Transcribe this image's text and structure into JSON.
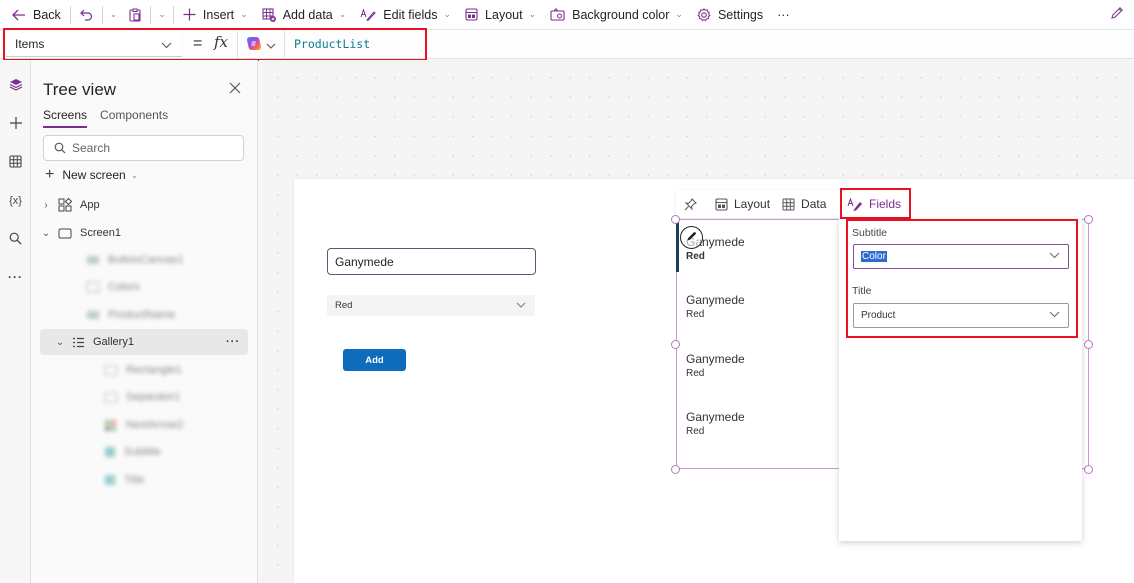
{
  "command_bar": {
    "back": "Back",
    "insert": "Insert",
    "add_data": "Add data",
    "edit_fields": "Edit fields",
    "layout": "Layout",
    "background_color": "Background color",
    "settings": "Settings",
    "more": "···"
  },
  "formula_bar": {
    "property": "Items",
    "equals": "=",
    "fx": "fx",
    "formula": "ProductList"
  },
  "tree_view": {
    "title": "Tree view",
    "tabs": [
      {
        "label": "Screens",
        "active": true
      },
      {
        "label": "Components",
        "active": false
      }
    ],
    "search_placeholder": "Search",
    "new_screen": "New screen",
    "items": [
      {
        "label": "App",
        "level": 0,
        "expanded": false
      },
      {
        "label": "Screen1",
        "level": 0,
        "expanded": true
      },
      {
        "label": "ButtonCanvas1",
        "level": 1,
        "blurred": true
      },
      {
        "label": "Colors",
        "level": 1,
        "blurred": true
      },
      {
        "label": "ProductName",
        "level": 1,
        "blurred": true
      },
      {
        "label": "Gallery1",
        "level": 1,
        "expanded": true,
        "selected": true
      },
      {
        "label": "Rectangle1",
        "level": 2,
        "blurred": true
      },
      {
        "label": "Separator1",
        "level": 2,
        "blurred": true
      },
      {
        "label": "NextArrow2",
        "level": 2,
        "blurred": true
      },
      {
        "label": "Subtitle",
        "level": 2,
        "blurred": true
      },
      {
        "label": "Title",
        "level": 2,
        "blurred": true
      }
    ],
    "more": "···"
  },
  "canvas": {
    "text_input_value": "Ganymede",
    "dropdown_value": "Red",
    "add_button": "Add"
  },
  "gallery_toolbar": {
    "layout": "Layout",
    "data": "Data",
    "fields": "Fields"
  },
  "gallery": {
    "items": [
      {
        "title": "Ganymede",
        "subtitle": "Red"
      },
      {
        "title": "Ganymede",
        "subtitle": "Red"
      },
      {
        "title": "Ganymede",
        "subtitle": "Red"
      },
      {
        "title": "Ganymede",
        "subtitle": "Red"
      }
    ]
  },
  "fields_panel": {
    "subtitle_label": "Subtitle",
    "subtitle_value": "Color",
    "title_label": "Title",
    "title_value": "Product"
  },
  "colors": {
    "accent": "#7a2f8e",
    "highlight": "#e81123",
    "button": "#0f6cbd",
    "formula_text": "#0a7d8c"
  }
}
